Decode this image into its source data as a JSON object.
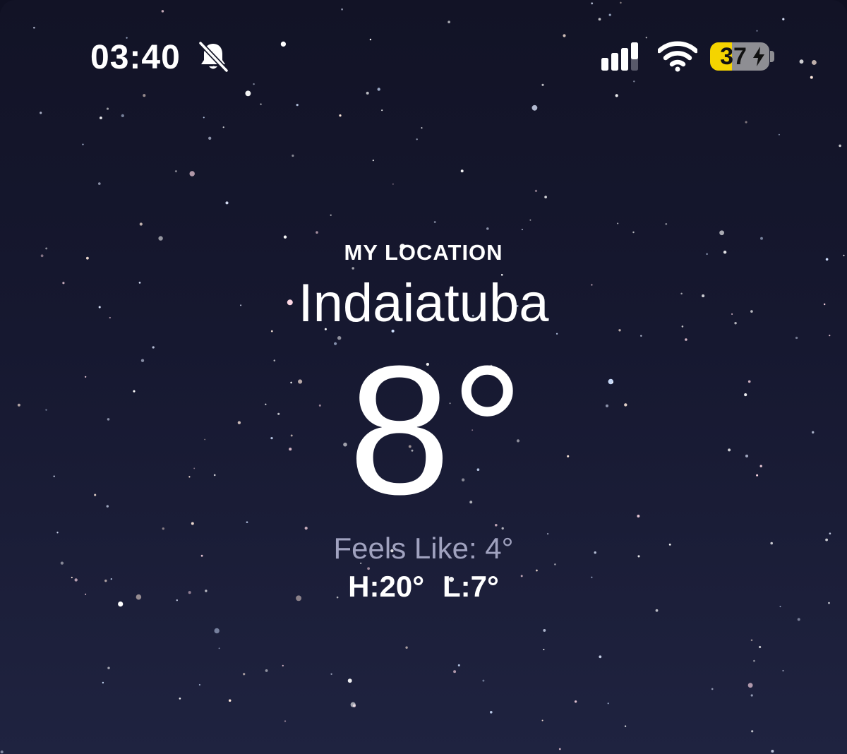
{
  "status_bar": {
    "time": "03:40",
    "silent_icon": "bell-slash-icon",
    "signal_icon": "cellular-signal-icon",
    "wifi_icon": "wifi-icon",
    "battery_percent": "37",
    "battery_level": 0.37,
    "battery_charging_icon": "bolt-icon",
    "battery_color": "#f5d400"
  },
  "weather": {
    "location_label": "MY LOCATION",
    "city": "Indaiatuba",
    "temperature": "8°",
    "feels_like": "Feels Like: 4°",
    "high": "H:20°",
    "low": "L:7°"
  },
  "background": {
    "style": "night-sky-stars",
    "sky_color": "#151729"
  }
}
